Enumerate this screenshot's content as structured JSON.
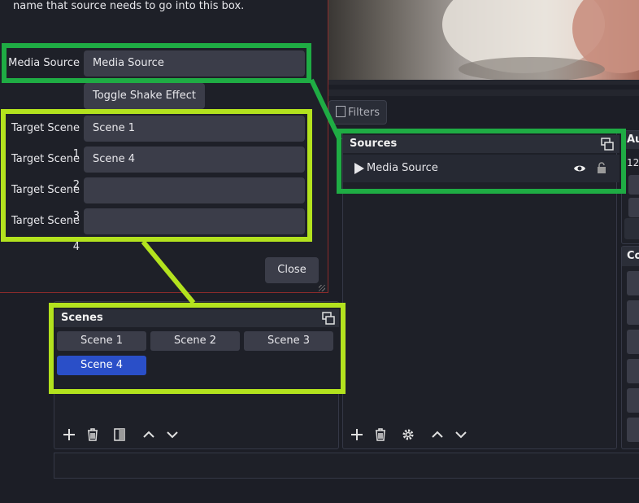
{
  "dialog": {
    "instruction": "name that source needs to go into this box.",
    "media_source_label": "Media Source",
    "media_source_value": "Media Source",
    "toggle_label": "Toggle Shake Effect",
    "targets": [
      {
        "label": "Target Scene 1",
        "value": "Scene 1"
      },
      {
        "label": "Target Scene 2",
        "value": "Scene 4"
      },
      {
        "label": "Target Scene 3",
        "value": ""
      },
      {
        "label": "Target Scene 4",
        "value": ""
      }
    ],
    "close_label": "Close"
  },
  "filters_label": "Filters",
  "sources": {
    "title": "Sources",
    "item_label": "Media Source"
  },
  "audio": {
    "title_partial": "Au",
    "value_partial": "12"
  },
  "controls": {
    "title_partial": "Co"
  },
  "scenes": {
    "title": "Scenes",
    "items": [
      "Scene 1",
      "Scene 2",
      "Scene 3",
      "Scene 4"
    ],
    "active": "Scene 4"
  },
  "colors": {
    "annotation_green": "#1fac44",
    "annotation_lime": "#b3e21e",
    "active_scene": "#2a4fc8"
  },
  "icons": [
    "play-icon",
    "eye-icon",
    "lock-icon",
    "undock-icon",
    "plus-icon",
    "trash-icon",
    "filter-icon",
    "up-arrow-icon",
    "down-arrow-icon",
    "gear-icon"
  ]
}
